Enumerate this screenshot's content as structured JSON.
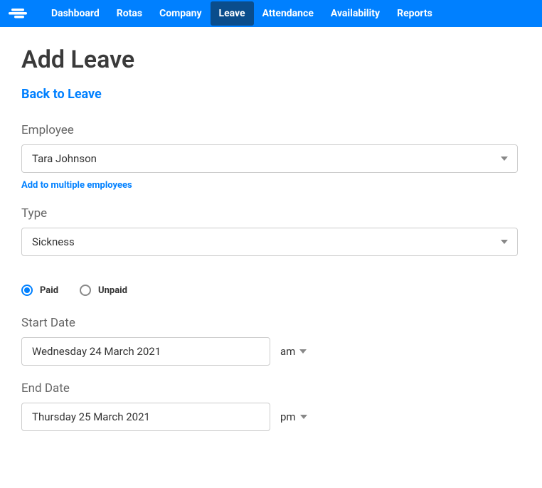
{
  "nav": {
    "items": [
      {
        "label": "Dashboard",
        "active": false
      },
      {
        "label": "Rotas",
        "active": false
      },
      {
        "label": "Company",
        "active": false
      },
      {
        "label": "Leave",
        "active": true
      },
      {
        "label": "Attendance",
        "active": false
      },
      {
        "label": "Availability",
        "active": false
      },
      {
        "label": "Reports",
        "active": false
      }
    ]
  },
  "page": {
    "title": "Add Leave",
    "back_link": "Back to Leave"
  },
  "form": {
    "employee": {
      "label": "Employee",
      "value": "Tara Johnson",
      "sub_link": "Add to multiple employees"
    },
    "type": {
      "label": "Type",
      "value": "Sickness"
    },
    "payment": {
      "options": [
        {
          "label": "Paid",
          "checked": true
        },
        {
          "label": "Unpaid",
          "checked": false
        }
      ]
    },
    "start_date": {
      "label": "Start Date",
      "value": "Wednesday 24 March 2021",
      "period": "am"
    },
    "end_date": {
      "label": "End Date",
      "value": "Thursday 25 March 2021",
      "period": "pm"
    }
  }
}
